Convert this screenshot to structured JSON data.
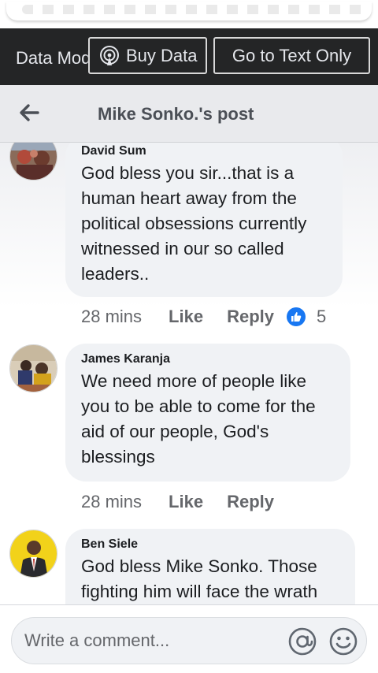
{
  "data_bar": {
    "mode_label": "Data Mode",
    "buy_label": "Buy Data",
    "text_only_label": "Go to Text Only"
  },
  "header": {
    "title": "Mike Sonko.'s post"
  },
  "comments": [
    {
      "author": "David Sum",
      "text": "God bless you sir...that is a human heart away from the political obsessions currently witnessed in our so called leaders..",
      "time": "28 mins",
      "like_label": "Like",
      "reply_label": "Reply",
      "reactions": "5"
    },
    {
      "author": "James Karanja",
      "text": "We need more of people like you to be able to come for the aid of our people, God's blessings",
      "time": "28 mins",
      "like_label": "Like",
      "reply_label": "Reply"
    },
    {
      "author": "Ben Siele",
      "text": "God bless Mike Sonko. Those fighting him will face the wrath"
    }
  ],
  "composer": {
    "placeholder": "Write a comment..."
  },
  "colors": {
    "accent": "#1877f2",
    "dark_bar": "#242526",
    "bubble": "#f0f2f5"
  }
}
